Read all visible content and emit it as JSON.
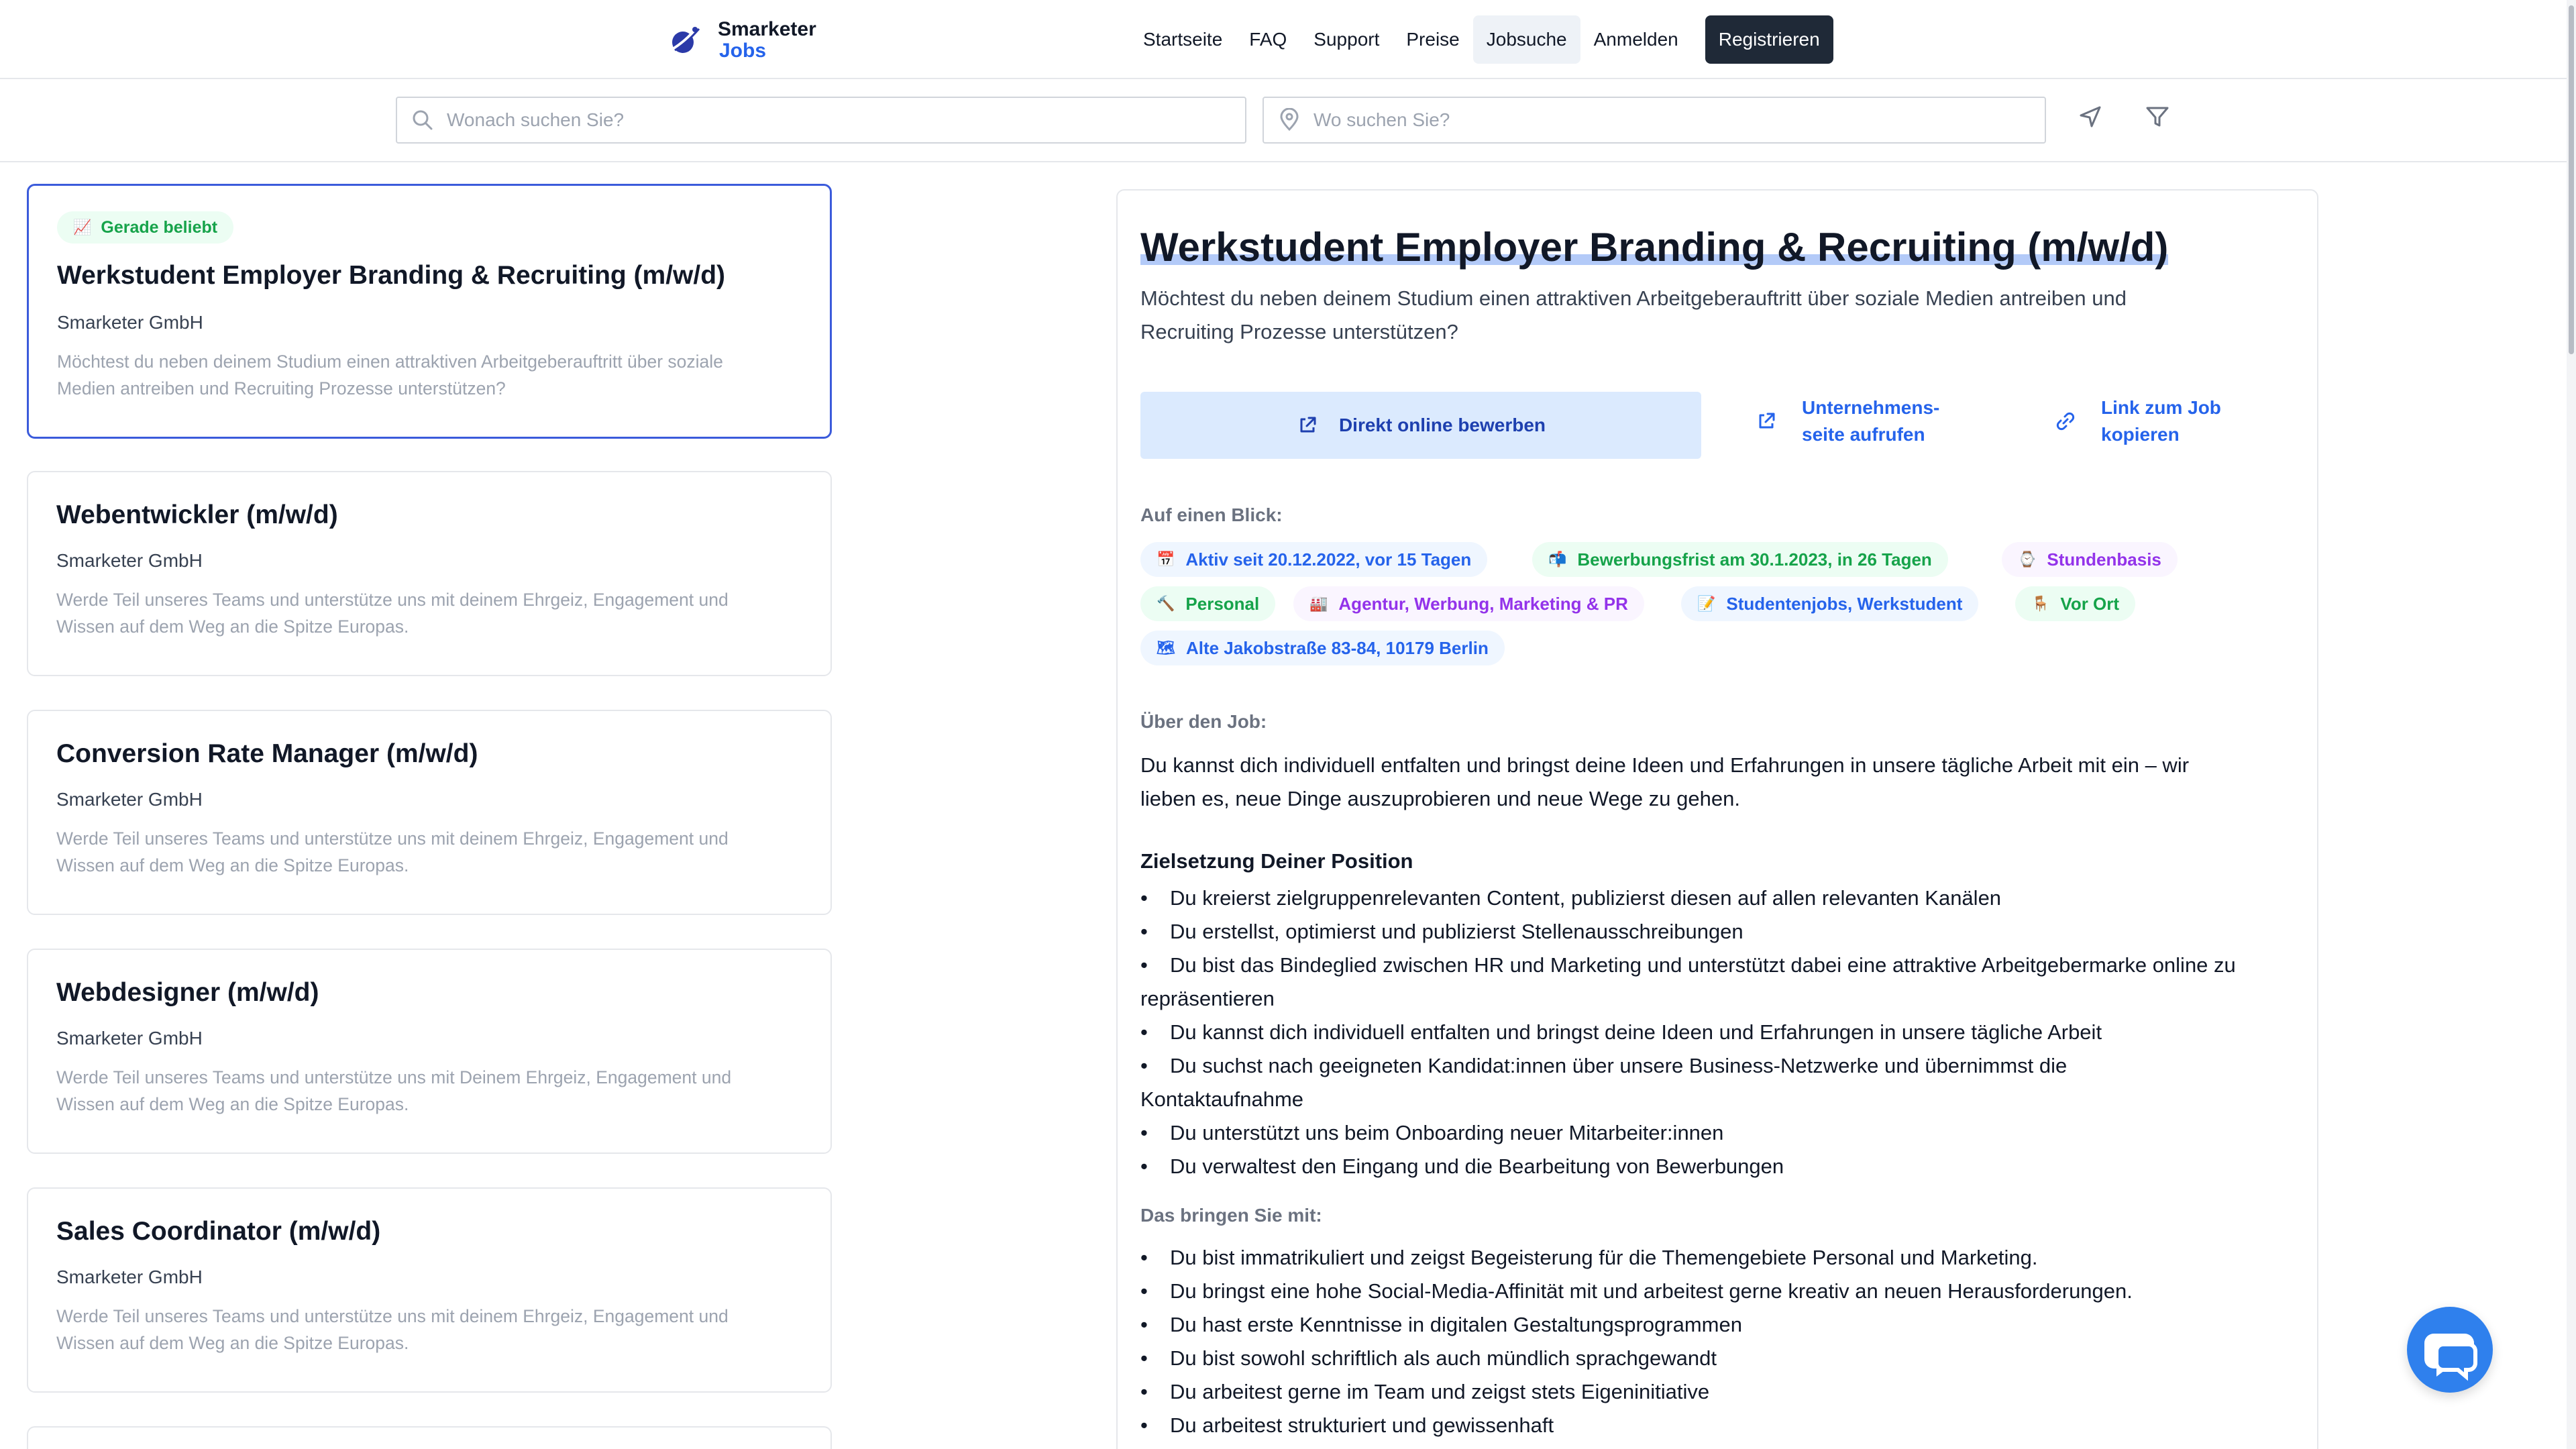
{
  "header": {
    "brand": "Smarketer",
    "brand_sub": "Jobs",
    "nav": [
      {
        "label": "Startseite"
      },
      {
        "label": "FAQ"
      },
      {
        "label": "Support"
      },
      {
        "label": "Preise"
      },
      {
        "label": "Jobsuche"
      },
      {
        "label": "Anmelden"
      },
      {
        "label": "Registrieren"
      }
    ]
  },
  "search": {
    "what_placeholder": "Wonach suchen Sie?",
    "where_placeholder": "Wo suchen Sie?",
    "what_value": "",
    "where_value": ""
  },
  "jobs": [
    {
      "badge": "Gerade beliebt",
      "badge_icon": "📈",
      "title": "Werkstudent Employer Branding & Recruiting (m/w/d)",
      "company": "Smarketer GmbH",
      "desc_line1": "Möchtest du neben deinem Studium einen attraktiven Arbeitgeberauftritt über soziale",
      "desc_line2": "Medien antreiben und Recruiting Prozesse unterstützen?"
    },
    {
      "title": "Webentwickler (m/w/d)",
      "company": "Smarketer GmbH",
      "desc_line1": "Werde Teil unseres Teams und unterstütze uns mit deinem Ehrgeiz, Engagement und",
      "desc_line2": "Wissen auf dem Weg an die Spitze Europas."
    },
    {
      "title": "Conversion Rate Manager (m/w/d)",
      "company": "Smarketer GmbH",
      "desc_line1": "Werde Teil unseres Teams und unterstütze uns mit deinem Ehrgeiz, Engagement und",
      "desc_line2": "Wissen auf dem Weg an die Spitze Europas."
    },
    {
      "title": "Webdesigner (m/w/d)",
      "company": "Smarketer GmbH",
      "desc_line1": "Werde Teil unseres Teams und unterstütze uns mit Deinem Ehrgeiz, Engagement und",
      "desc_line2": "Wissen auf dem Weg an die Spitze Europas."
    },
    {
      "title": "Sales Coordinator (m/w/d)",
      "company": "Smarketer GmbH",
      "desc_line1": "Werde Teil unseres Teams und unterstütze uns mit deinem Ehrgeiz, Engagement und",
      "desc_line2": "Wissen auf dem Weg an die Spitze Europas."
    }
  ],
  "detail": {
    "title": "Werkstudent Employer Branding & Recruiting (m/w/d)",
    "subtitle_line1": "Möchtest du neben deinem Studium einen attraktiven Arbeitgeberauftritt über soziale Medien antreiben und",
    "subtitle_line2": "Recruiting Prozesse unterstützen?",
    "apply_label": "Direkt online bewerben",
    "company_link_line1": "Unternehmens-",
    "company_link_line2": "seite aufrufen",
    "copy_link_line1": "Link zum Job",
    "copy_link_line2": "kopieren",
    "glance_label": "Auf einen Blick:",
    "tags": [
      {
        "icon": "📅",
        "label": "Aktiv seit 20.12.2022, vor 15 Tagen",
        "color": "blue"
      },
      {
        "icon": "📬",
        "label": "Bewerbungsfrist am 30.1.2023, in 26 Tagen",
        "color": "green"
      },
      {
        "icon": "⌚",
        "label": "Stundenbasis",
        "color": "purple"
      },
      {
        "icon": "🔨",
        "label": "Personal",
        "color": "green"
      },
      {
        "icon": "🏭",
        "label": "Agentur, Werbung, Marketing & PR",
        "color": "purple"
      },
      {
        "icon": "📝",
        "label": "Studentenjobs, Werkstudent",
        "color": "blue"
      },
      {
        "icon": "🪑",
        "label": "Vor Ort",
        "color": "green"
      },
      {
        "icon": "🗺",
        "label": "Alte Jakobstraße 83-84, 10179 Berlin",
        "color": "blue"
      }
    ],
    "about_label": "Über den Job:",
    "about_line1": "Du kannst dich individuell entfalten und bringst deine Ideen und Erfahrungen in unsere tägliche Arbeit mit ein – wir",
    "about_line2": "lieben es, neue Dinge auszuprobieren und neue Wege zu gehen.",
    "goals_heading": "Zielsetzung Deiner Position",
    "goals": [
      "Du kreierst zielgruppenrelevanten Content, publizierst diesen auf allen relevanten Kanälen",
      "Du erstellst, optimierst und publizierst Stellenausschreibungen",
      "Du bist das Bindeglied zwischen HR und Marketing und unterstützt dabei eine attraktive Arbeitgebermarke online zu",
      "repräsentieren",
      "Du kannst dich individuell entfalten und bringst deine Ideen und Erfahrungen in unsere tägliche Arbeit",
      "Du suchst nach geeigneten Kandidat:innen über unsere Business-Netzwerke und übernimmst die",
      "Kontaktaufnahme",
      "Du unterstützt uns beim Onboarding neuer Mitarbeiter:innen",
      "Du verwaltest den Eingang und die Bearbeitung von Bewerbungen"
    ],
    "requirements_label": "Das bringen Sie mit:",
    "requirements": [
      "Du bist immatrikuliert und zeigst Begeisterung für die Themengebiete Personal und Marketing.",
      "Du bringst eine hohe Social-Media-Affinität mit und arbeitest gerne kreativ an neuen Herausforderungen.",
      "Du hast erste Kenntnisse in digitalen Gestaltungsprogrammen",
      "Du bist sowohl schriftlich als auch mündlich sprachgewandt",
      "Du arbeitest gerne im Team und zeigst stets Eigeninitiative",
      "Du arbeitest strukturiert und gewissenhaft"
    ]
  },
  "colors": {
    "accent": "#2563eb",
    "selected_border": "#3b5bdb",
    "apply_bg": "#dbeafe",
    "chat": "#2f80ed"
  }
}
